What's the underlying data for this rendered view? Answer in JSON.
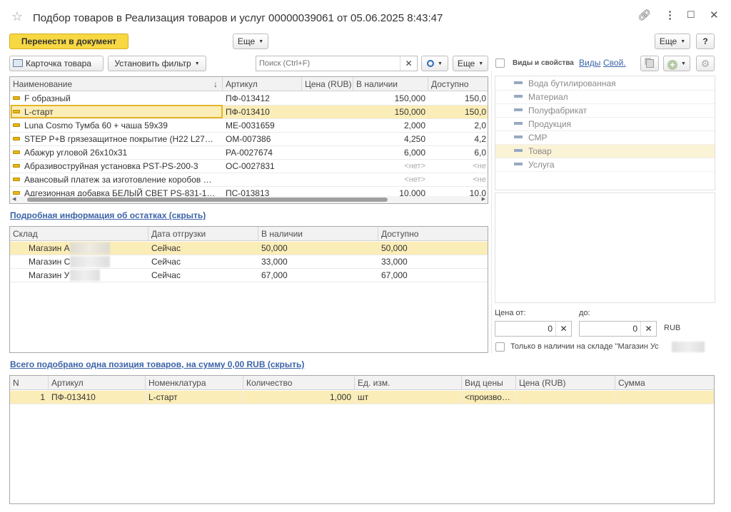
{
  "window": {
    "title": "Подбор товаров в Реализация товаров и услуг 00000039061 от 05.06.2025 8:43:47"
  },
  "toolbar_top": {
    "transfer_label": "Перенести в документ",
    "more_label": "Еще",
    "more_right_label": "Еще",
    "help_label": "?"
  },
  "toolbar_list": {
    "card_label": "Карточка товара",
    "filter_label": "Установить фильтр",
    "search_placeholder": "Поиск (Ctrl+F)",
    "more_label": "Еще"
  },
  "goods_table": {
    "headers": [
      "Наименование",
      "Артикул",
      "Цена (RUB)",
      "В наличии",
      "Доступно"
    ],
    "rows": [
      {
        "name": "F образный",
        "sku": "ПФ-013412",
        "price": "",
        "stock": "150,000",
        "avail": "150,0"
      },
      {
        "name": "L-старт",
        "sku": "ПФ-013410",
        "price": "",
        "stock": "150,000",
        "avail": "150,0"
      },
      {
        "name": "Luna Cosmo Тумба 60 + чаша 59x39",
        "sku": "МЕ-0031659",
        "price": "",
        "stock": "2,000",
        "avail": "2,0"
      },
      {
        "name": "STEP  P+B грязезащитное покрытие (H22  L27…",
        "sku": "ОМ-007386",
        "price": "",
        "stock": "4,250",
        "avail": "4,2"
      },
      {
        "name": "Абажур угловой 26x10x31",
        "sku": "РА-0027674",
        "price": "",
        "stock": "6,000",
        "avail": "6,0"
      },
      {
        "name": "Абразивоструйная установка PST-PS-200-3",
        "sku": "ОС-0027831",
        "price": "",
        "stock": "<нет>",
        "avail": "<не"
      },
      {
        "name": "Авансовый платеж за изготовление коробов …",
        "sku": "",
        "price": "",
        "stock": "<нет>",
        "avail": "<не"
      },
      {
        "name": "Адгезионная добавка БЕЛЫЙ СВЕТ PS-831-1…",
        "sku": "ПС-013813",
        "price": "",
        "stock": "10,000",
        "avail": "10,0"
      }
    ]
  },
  "properties": {
    "checkbox_label": "Виды и свойства",
    "link_kinds": "Виды",
    "link_props": "Свой.",
    "items": [
      "Вода бутилированная",
      "Материал",
      "Полуфабрикат",
      "Продукция",
      "СМР",
      "Товар",
      "Услуга"
    ]
  },
  "stock_details": {
    "link": "Подробная информация об остатках (скрыть)",
    "headers": [
      "Склад",
      "Дата отгрузки",
      "В наличии",
      "Доступно"
    ],
    "rows": [
      {
        "store": "Магазин А",
        "date": "Сейчас",
        "stock": "50,000",
        "avail": "50,000"
      },
      {
        "store": "Магазин С",
        "date": "Сейчас",
        "stock": "33,000",
        "avail": "33,000"
      },
      {
        "store": "Магазин У",
        "date": "Сейчас",
        "stock": "67,000",
        "avail": "67,000"
      }
    ]
  },
  "price_filter": {
    "from_label": "Цена от:",
    "to_label": "до:",
    "from_value": "0",
    "to_value": "0",
    "currency": "RUB",
    "only_stock_label": "Только в наличии на складе \"Магазин Ус"
  },
  "selected": {
    "link": "Всего подобрано одна позиция товаров, на сумму 0,00 RUB (скрыть)",
    "headers": [
      "N",
      "Артикул",
      "Номенклатура",
      "Количество",
      "Ед. изм.",
      "Вид цены",
      "Цена (RUB)",
      "Сумма"
    ],
    "rows": [
      {
        "n": "1",
        "sku": "ПФ-013410",
        "name": "L-старт",
        "qty": "1,000",
        "unit": "шт",
        "price_kind": "<произво…",
        "price": "",
        "sum": ""
      }
    ]
  },
  "colors": {
    "accent_yellow": "#f7d842",
    "selected_row": "#fbedb7",
    "link_blue": "#3b63a8"
  }
}
